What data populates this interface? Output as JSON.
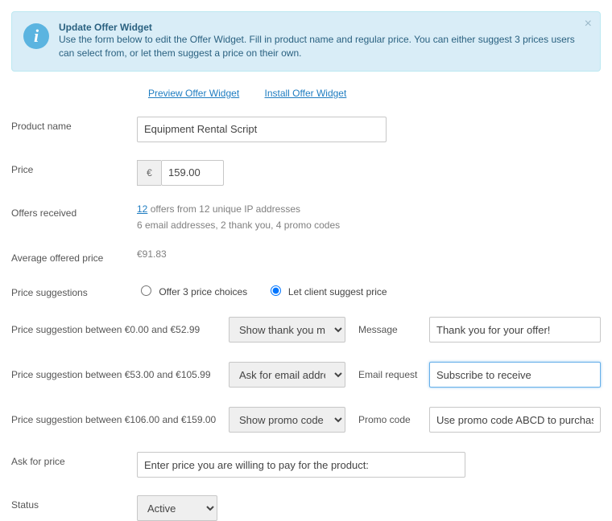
{
  "infobox": {
    "title": "Update Offer Widget",
    "description": "Use the form below to edit the Offer Widget. Fill in product name and regular price. You can either suggest 3 prices users can select from, or let them suggest a price on their own.",
    "close_glyph": "×"
  },
  "links": {
    "preview": "Preview Offer Widget",
    "install": "Install Offer Widget"
  },
  "labels": {
    "product_name": "Product name",
    "price": "Price",
    "offers_received": "Offers received",
    "average_price": "Average offered price",
    "price_suggestions": "Price suggestions",
    "ask_for_price": "Ask for price",
    "status": "Status"
  },
  "values": {
    "product_name": "Equipment Rental Script",
    "currency_symbol": "€",
    "price": "159.00",
    "offers_count": "12",
    "offers_line_remainder": " offers from 12 unique IP addresses",
    "offers_line2": "6 email addresses, 2 thank you, 4 promo codes",
    "average_price": "€91.83",
    "ask_for_price": "Enter price you are willing to pay for the product:"
  },
  "price_suggestions": {
    "option_choices_label": "Offer 3 price choices",
    "option_client_label": "Let client suggest price",
    "selected": "client"
  },
  "suggestion_rows": [
    {
      "range_text": "Price suggestion between €0.00 and €52.99",
      "action_value": "Show thank you message",
      "field_label": "Message",
      "field_value": "Thank you for your offer!",
      "focused": false
    },
    {
      "range_text": "Price suggestion between €53.00 and €105.99",
      "action_value": "Ask for email address",
      "field_label": "Email request",
      "field_value": "Subscribe to receive",
      "focused": true
    },
    {
      "range_text": "Price suggestion between €106.00 and €159.00",
      "action_value": "Show promo code",
      "field_label": "Promo code",
      "field_value": "Use promo code ABCD to purchase",
      "focused": false
    }
  ],
  "status": {
    "value": "Active"
  },
  "info_icon_glyph": "i"
}
